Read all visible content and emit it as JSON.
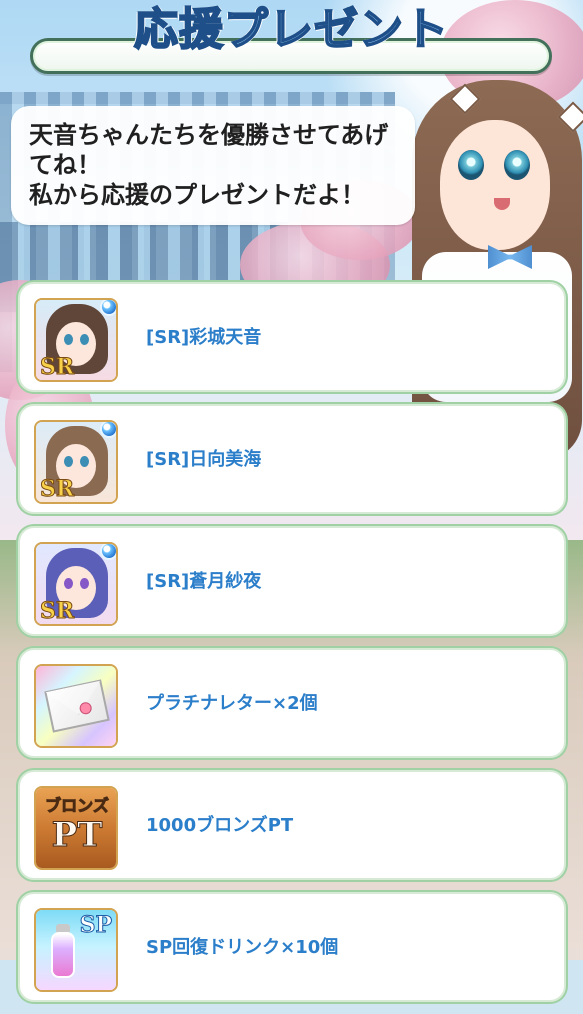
{
  "header": {
    "title": "応援プレゼント"
  },
  "speech": {
    "lines": [
      "天音ちゃんたちを優勝させてあげ",
      "てね！",
      "私から応援のプレゼントだよ！"
    ]
  },
  "rewards": [
    {
      "label": "[SR]彩城天音",
      "icon": "sr-character-portrait-icon",
      "rarity": "SR"
    },
    {
      "label": "[SR]日向美海",
      "icon": "sr-character-portrait-icon",
      "rarity": "SR"
    },
    {
      "label": "[SR]蒼月紗夜",
      "icon": "sr-character-portrait-icon",
      "rarity": "SR"
    },
    {
      "label": "プラチナレター×2個",
      "icon": "platinum-letter-icon"
    },
    {
      "label": "1000ブロンズPT",
      "icon": "bronze-pt-icon",
      "icon_text_top": "ブロンズ",
      "icon_text_main": "PT"
    },
    {
      "label": "SP回復ドリンク×10個",
      "icon": "sp-drink-icon",
      "icon_text": "SP"
    }
  ],
  "colors": {
    "title_fill": "#8dc0ec",
    "title_outline": "#1e4f88",
    "reward_text": "#2b7ec9",
    "card_border": "#9fd1a4"
  }
}
